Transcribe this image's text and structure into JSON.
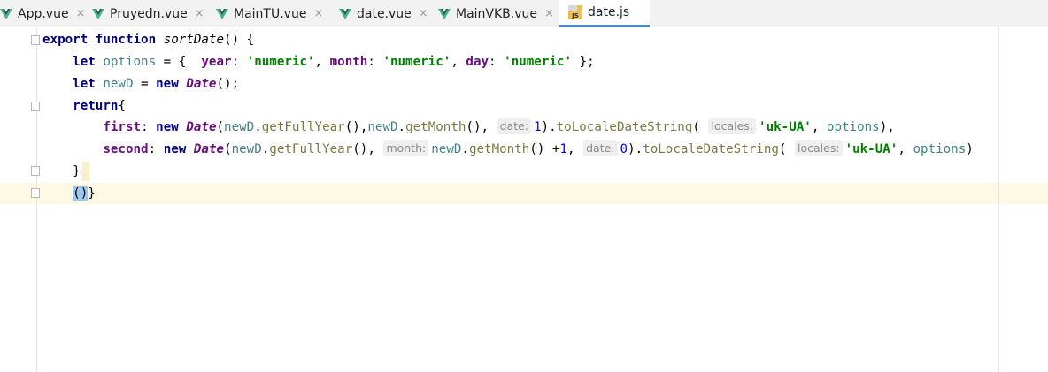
{
  "tabs": [
    {
      "label": "App.vue",
      "icon": "vue-icon",
      "active": false
    },
    {
      "label": "Pruyedn.vue",
      "icon": "vue-icon",
      "active": false
    },
    {
      "label": "MainTU.vue",
      "icon": "vue-icon",
      "active": false
    },
    {
      "label": "date.vue",
      "icon": "vue-icon",
      "active": false
    },
    {
      "label": "MainVKB.vue",
      "icon": "vue-icon",
      "active": false
    },
    {
      "label": "date.js",
      "icon": "js-file-icon",
      "active": true
    }
  ],
  "tab_close_glyph": "×",
  "colors": {
    "vue_green": "#41b883",
    "active_tab_underline": "#4a88c7",
    "caret_line": "#fdf9e4",
    "keyword": "#000080",
    "string": "#008000"
  },
  "code": {
    "l1_kw1": "export",
    "l1_kw2": "function",
    "l1_name": "sortDate",
    "l1_tail": "() {",
    "l2_kw": "let",
    "l2_var": "options",
    "l2_eq": " = {  ",
    "l2_p1": "year",
    "l2_s1": "'numeric'",
    "l2_p2": "month",
    "l2_s2": "'numeric'",
    "l2_p3": "day",
    "l2_s3": "'numeric'",
    "l2_end": " };",
    "l3_kw": "let",
    "l3_var": "newD",
    "l3_eq": " = ",
    "l3_new": "new",
    "l3_cls": "Date",
    "l3_end": "();",
    "l4_kw": "return",
    "l4_brace": "{",
    "l5_prop": "first",
    "l5_new": "new",
    "l5_cls": "Date",
    "l5_var1": "newD",
    "l5_m1": "getFullYear",
    "l5_var2": "newD",
    "l5_m2": "getMonth",
    "l5_hint1": "date:",
    "l5_num": "1",
    "l5_m3": "toLocaleDateString",
    "l5_hint2": "locales:",
    "l5_str": "'uk-UA'",
    "l5_opts": "options",
    "l5_end": "),",
    "l6_prop": "second",
    "l6_new": "new",
    "l6_cls": "Date",
    "l6_var1": "newD",
    "l6_m1": "getFullYear",
    "l6_hint1": "month:",
    "l6_var2": "newD",
    "l6_m2": "getMonth",
    "l6_plus": " +",
    "l6_num1": "1",
    "l6_hint2": "date:",
    "l6_num2": "0",
    "l6_m3": "toLocaleDateString",
    "l6_hint3": "locales:",
    "l6_str": "'uk-UA'",
    "l6_opts": "options",
    "l6_end": ")",
    "l7_brace": "}",
    "l8_paren": "()",
    "l8_brace": "}"
  }
}
